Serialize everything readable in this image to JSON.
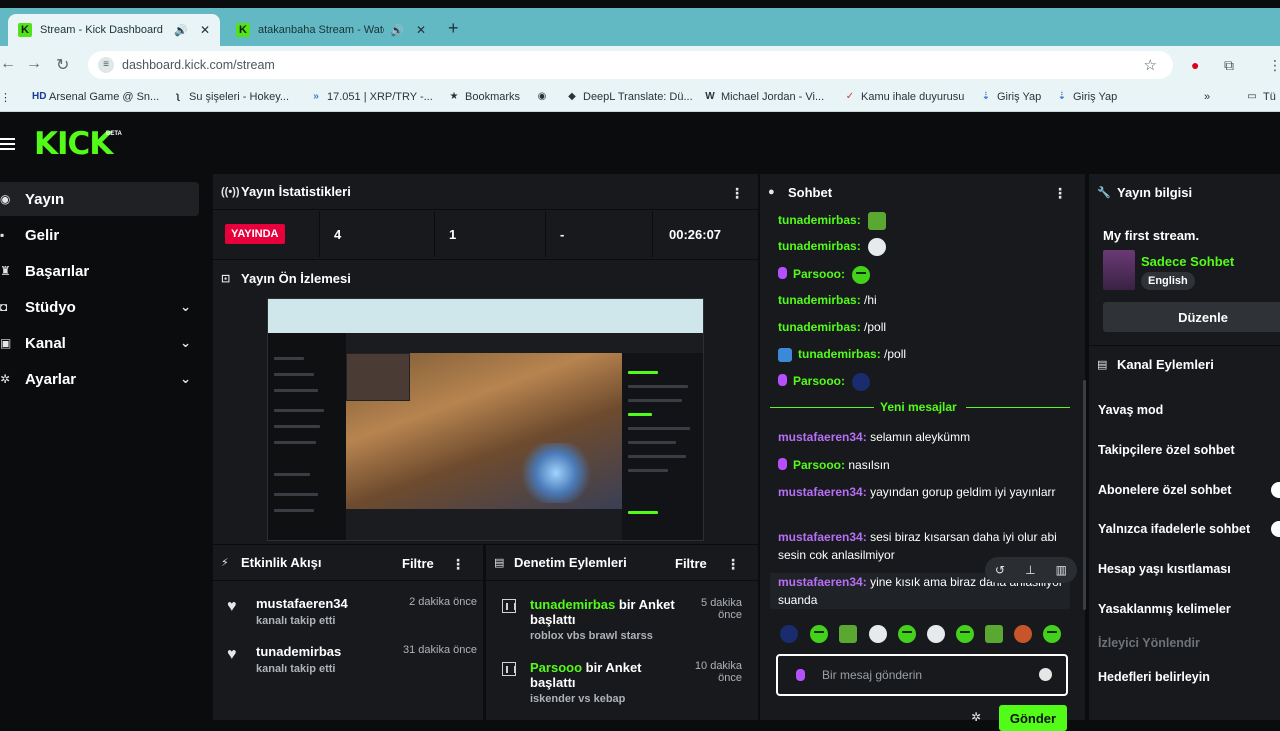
{
  "browser": {
    "tabs": [
      {
        "title": "Stream - Kick Dashboard"
      },
      {
        "title": "atakanbaha Stream - Watch"
      }
    ],
    "url": "dashboard.kick.com/stream",
    "bookmarks": [
      {
        "label": "Arsenal Game @ Sn..."
      },
      {
        "label": "Su şişeleri - Hokey..."
      },
      {
        "label": "17.051 | XRP/TRY -..."
      },
      {
        "label": "Bookmarks"
      },
      {
        "label": ""
      },
      {
        "label": "DeepL Translate: Dü..."
      },
      {
        "label": "Michael Jordan - Vi..."
      },
      {
        "label": "Kamu ihale duyurusu"
      },
      {
        "label": "Giriş Yap"
      },
      {
        "label": "Giriş Yap"
      },
      {
        "label": "Tü"
      }
    ]
  },
  "brand": {
    "logo": "KICK",
    "badge": "BETA",
    "accent": "#53fc18",
    "live": "#e8003c"
  },
  "sidebar": {
    "items": [
      {
        "label": "Yayın"
      },
      {
        "label": "Gelir"
      },
      {
        "label": "Başarılar"
      },
      {
        "label": "Stüdyo"
      },
      {
        "label": "Kanal"
      },
      {
        "label": "Ayarlar"
      }
    ]
  },
  "stats": {
    "title": "Yayın İstatistikleri",
    "live_badge": "YAYINDA",
    "viewers": "4",
    "followers": "1",
    "subs": "-",
    "duration": "00:26:07"
  },
  "preview": {
    "title": "Yayın Ön İzlemesi"
  },
  "activity": {
    "title": "Etkinlik Akışı",
    "filter": "Filtre",
    "items": [
      {
        "user": "mustafaeren34",
        "text": "kanalı takip etti",
        "time": "2 dakika önce"
      },
      {
        "user": "tunademirbas",
        "text": "kanalı takip etti",
        "time": "31 dakika önce"
      }
    ]
  },
  "moderation": {
    "title": "Denetim Eylemleri",
    "filter": "Filtre",
    "items": [
      {
        "user": "tunademirbas",
        "action": "bir Anket",
        "action2": "başlattı",
        "detail": "roblox vbs brawl starss",
        "time1": "5 dakika",
        "time2": "önce"
      },
      {
        "user": "Parsooo",
        "action": "bir Anket",
        "action2": "başlattı",
        "detail": "iskender vs kebap",
        "time1": "10 dakika",
        "time2": "önce"
      }
    ]
  },
  "chat": {
    "title": "Sohbet",
    "messages": [
      {
        "user": "tunademirbas",
        "text": ""
      },
      {
        "user": "tunademirbas",
        "text": ""
      },
      {
        "user": "Parsooo",
        "text": ""
      },
      {
        "user": "tunademirbas",
        "text": "/hi"
      },
      {
        "user": "tunademirbas",
        "text": "/poll"
      },
      {
        "user": "tunademirbas",
        "text": "/poll"
      },
      {
        "user": "Parsooo",
        "text": ""
      },
      {
        "user": "mustafaeren34",
        "text": "selamın aleykümm"
      },
      {
        "user": "Parsooo",
        "text": "nasılsın"
      },
      {
        "user": "mustafaeren34",
        "text": "yayından gorup geldim iyi yayınlarr"
      },
      {
        "user": "mustafaeren34",
        "text": "sesi biraz kısarsan daha iyi olur abi sesin cok anlasilmiyor"
      },
      {
        "user": "mustafaeren34",
        "text": "yine kısık ama biraz daha anlasiliyor suanda"
      }
    ],
    "new_messages_label": "Yeni mesajlar",
    "input_placeholder": "Bir mesaj gönderin",
    "send_label": "Gönder"
  },
  "stream_info": {
    "title": "Yayın bilgisi",
    "stream_title": "My first stream.",
    "category": "Sadece Sohbet",
    "language": "English",
    "edit_label": "Düzenle"
  },
  "channel_actions": {
    "title": "Kanal Eylemleri",
    "items": [
      {
        "label": "Yavaş mod"
      },
      {
        "label": "Takipçilere özel sohbet"
      },
      {
        "label": "Abonelere özel sohbet"
      },
      {
        "label": "Yalnızca ifadelerle sohbet"
      },
      {
        "label": "Hesap yaşı kısıtlaması"
      },
      {
        "label": "Yasaklanmış kelimeler"
      },
      {
        "label": "İzleyici Yönlendir"
      },
      {
        "label": "Hedefleri belirleyin"
      }
    ]
  }
}
